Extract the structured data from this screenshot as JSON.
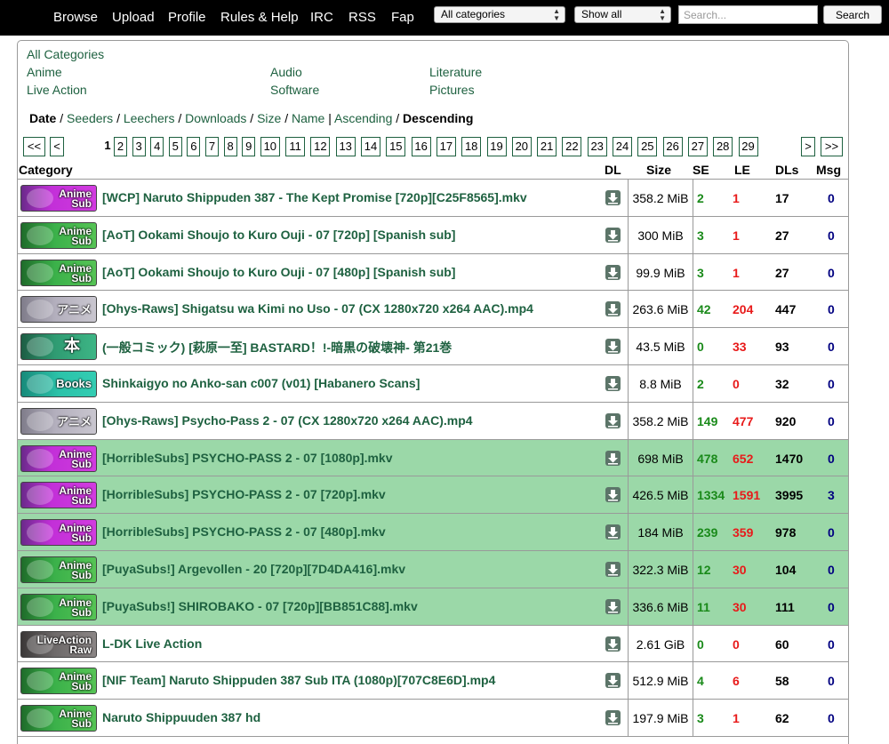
{
  "nav": {
    "links": [
      "Browse",
      "Upload",
      "Profile",
      "Rules & Help",
      "IRC",
      "RSS",
      "Fap"
    ],
    "category_select": "All categories",
    "filter_select": "Show all",
    "search_placeholder": "Search...",
    "search_button": "Search"
  },
  "categories": {
    "all": "All Categories",
    "col1": [
      "Anime",
      "Live Action"
    ],
    "col2": [
      "Audio",
      "Software"
    ],
    "col3": [
      "Literature",
      "Pictures"
    ]
  },
  "sort": {
    "date": "Date",
    "seeders": "Seeders",
    "leechers": "Leechers",
    "downloads": "Downloads",
    "size": "Size",
    "name": "Name",
    "ascending": "Ascending",
    "descending": "Descending",
    "sep": "/",
    "bar": "|"
  },
  "pagination": {
    "first": "<<",
    "prev": "<",
    "current": "1",
    "pages": [
      "2",
      "3",
      "4",
      "5",
      "6",
      "7",
      "8",
      "9",
      "10",
      "11",
      "12",
      "13",
      "14",
      "15",
      "16",
      "17",
      "18",
      "19",
      "20",
      "21",
      "22",
      "23",
      "24",
      "25",
      "26",
      "27",
      "28",
      "29"
    ],
    "next": ">",
    "last": ">>"
  },
  "headers": {
    "category": "Category",
    "dl": "DL",
    "size": "Size",
    "se": "SE",
    "le": "LE",
    "dls": "DLs",
    "msg": "Msg"
  },
  "colors": {
    "link": "#1e6140",
    "trusted_row": "#9bd8a8",
    "seeders": "#1a8a1a",
    "leechers": "#e81a1a",
    "messages": "#000080"
  },
  "torrents": [
    {
      "badge": "Anime\nSub",
      "badge_kind": "anime-sub-purple",
      "title": "[WCP] Naruto Shippuden 387 - The Kept Promise [720p][C25F8565].mkv",
      "size": "358.2 MiB",
      "se": "2",
      "le": "1",
      "dls": "17",
      "msg": "0",
      "trusted": false
    },
    {
      "badge": "Anime\nSub",
      "badge_kind": "anime-sub-green",
      "title": "[AoT] Ookami Shoujo to Kuro Ouji - 07 [720p] [Spanish sub]",
      "size": "300 MiB",
      "se": "3",
      "le": "1",
      "dls": "27",
      "msg": "0",
      "trusted": false
    },
    {
      "badge": "Anime\nSub",
      "badge_kind": "anime-sub-green",
      "title": "[AoT] Ookami Shoujo to Kuro Ouji - 07 [480p] [Spanish sub]",
      "size": "99.9 MiB",
      "se": "3",
      "le": "1",
      "dls": "27",
      "msg": "0",
      "trusted": false
    },
    {
      "badge": "アニメ",
      "badge_kind": "anime-raw-gray",
      "title": "[Ohys-Raws] Shigatsu wa Kimi no Uso - 07 (CX 1280x720 x264 AAC).mp4",
      "size": "263.6 MiB",
      "se": "42",
      "le": "204",
      "dls": "447",
      "msg": "0",
      "trusted": false
    },
    {
      "badge": "本",
      "badge_kind": "literature-raw-teal",
      "title": "(一般コミック) [萩原一至] BASTARD！!-暗黒の破壊神- 第21巻",
      "size": "43.5 MiB",
      "se": "0",
      "le": "33",
      "dls": "93",
      "msg": "0",
      "trusted": false
    },
    {
      "badge": "Books",
      "badge_kind": "books-teal",
      "title": "Shinkaigyo no Anko-san c007 (v01) [Habanero Scans]",
      "size": "8.8 MiB",
      "se": "2",
      "le": "0",
      "dls": "32",
      "msg": "0",
      "trusted": false
    },
    {
      "badge": "アニメ",
      "badge_kind": "anime-raw-gray",
      "title": "[Ohys-Raws] Psycho-Pass 2 - 07 (CX 1280x720 x264 AAC).mp4",
      "size": "358.2 MiB",
      "se": "149",
      "le": "477",
      "dls": "920",
      "msg": "0",
      "trusted": false
    },
    {
      "badge": "Anime\nSub",
      "badge_kind": "anime-sub-purple",
      "title": "[HorribleSubs] PSYCHO-PASS 2 - 07 [1080p].mkv",
      "size": "698 MiB",
      "se": "478",
      "le": "652",
      "dls": "1470",
      "msg": "0",
      "trusted": true
    },
    {
      "badge": "Anime\nSub",
      "badge_kind": "anime-sub-purple",
      "title": "[HorribleSubs] PSYCHO-PASS 2 - 07 [720p].mkv",
      "size": "426.5 MiB",
      "se": "1334",
      "le": "1591",
      "dls": "3995",
      "msg": "3",
      "trusted": true
    },
    {
      "badge": "Anime\nSub",
      "badge_kind": "anime-sub-purple",
      "title": "[HorribleSubs] PSYCHO-PASS 2 - 07 [480p].mkv",
      "size": "184 MiB",
      "se": "239",
      "le": "359",
      "dls": "978",
      "msg": "0",
      "trusted": true
    },
    {
      "badge": "Anime\nSub",
      "badge_kind": "anime-sub-green",
      "title": "[PuyaSubs!] Argevollen - 20 [720p][7D4DA416].mkv",
      "size": "322.3 MiB",
      "se": "12",
      "le": "30",
      "dls": "104",
      "msg": "0",
      "trusted": true
    },
    {
      "badge": "Anime\nSub",
      "badge_kind": "anime-sub-green",
      "title": "[PuyaSubs!] SHIROBAKO - 07 [720p][BB851C88].mkv",
      "size": "336.6 MiB",
      "se": "11",
      "le": "30",
      "dls": "111",
      "msg": "0",
      "trusted": true
    },
    {
      "badge": "LiveAction\nRaw",
      "badge_kind": "liveaction-raw-gray",
      "title": "L-DK Live Action",
      "size": "2.61 GiB",
      "se": "0",
      "le": "0",
      "dls": "60",
      "msg": "0",
      "trusted": false
    },
    {
      "badge": "Anime\nSub",
      "badge_kind": "anime-sub-green",
      "title": "[NIF Team] Naruto Shippuden 387 Sub ITA (1080p)[707C8E6D].mp4",
      "size": "512.9 MiB",
      "se": "4",
      "le": "6",
      "dls": "58",
      "msg": "0",
      "trusted": false
    },
    {
      "badge": "Anime\nSub",
      "badge_kind": "anime-sub-green",
      "title": "Naruto Shippuuden 387 hd",
      "size": "197.9 MiB",
      "se": "3",
      "le": "1",
      "dls": "62",
      "msg": "0",
      "trusted": false
    }
  ]
}
